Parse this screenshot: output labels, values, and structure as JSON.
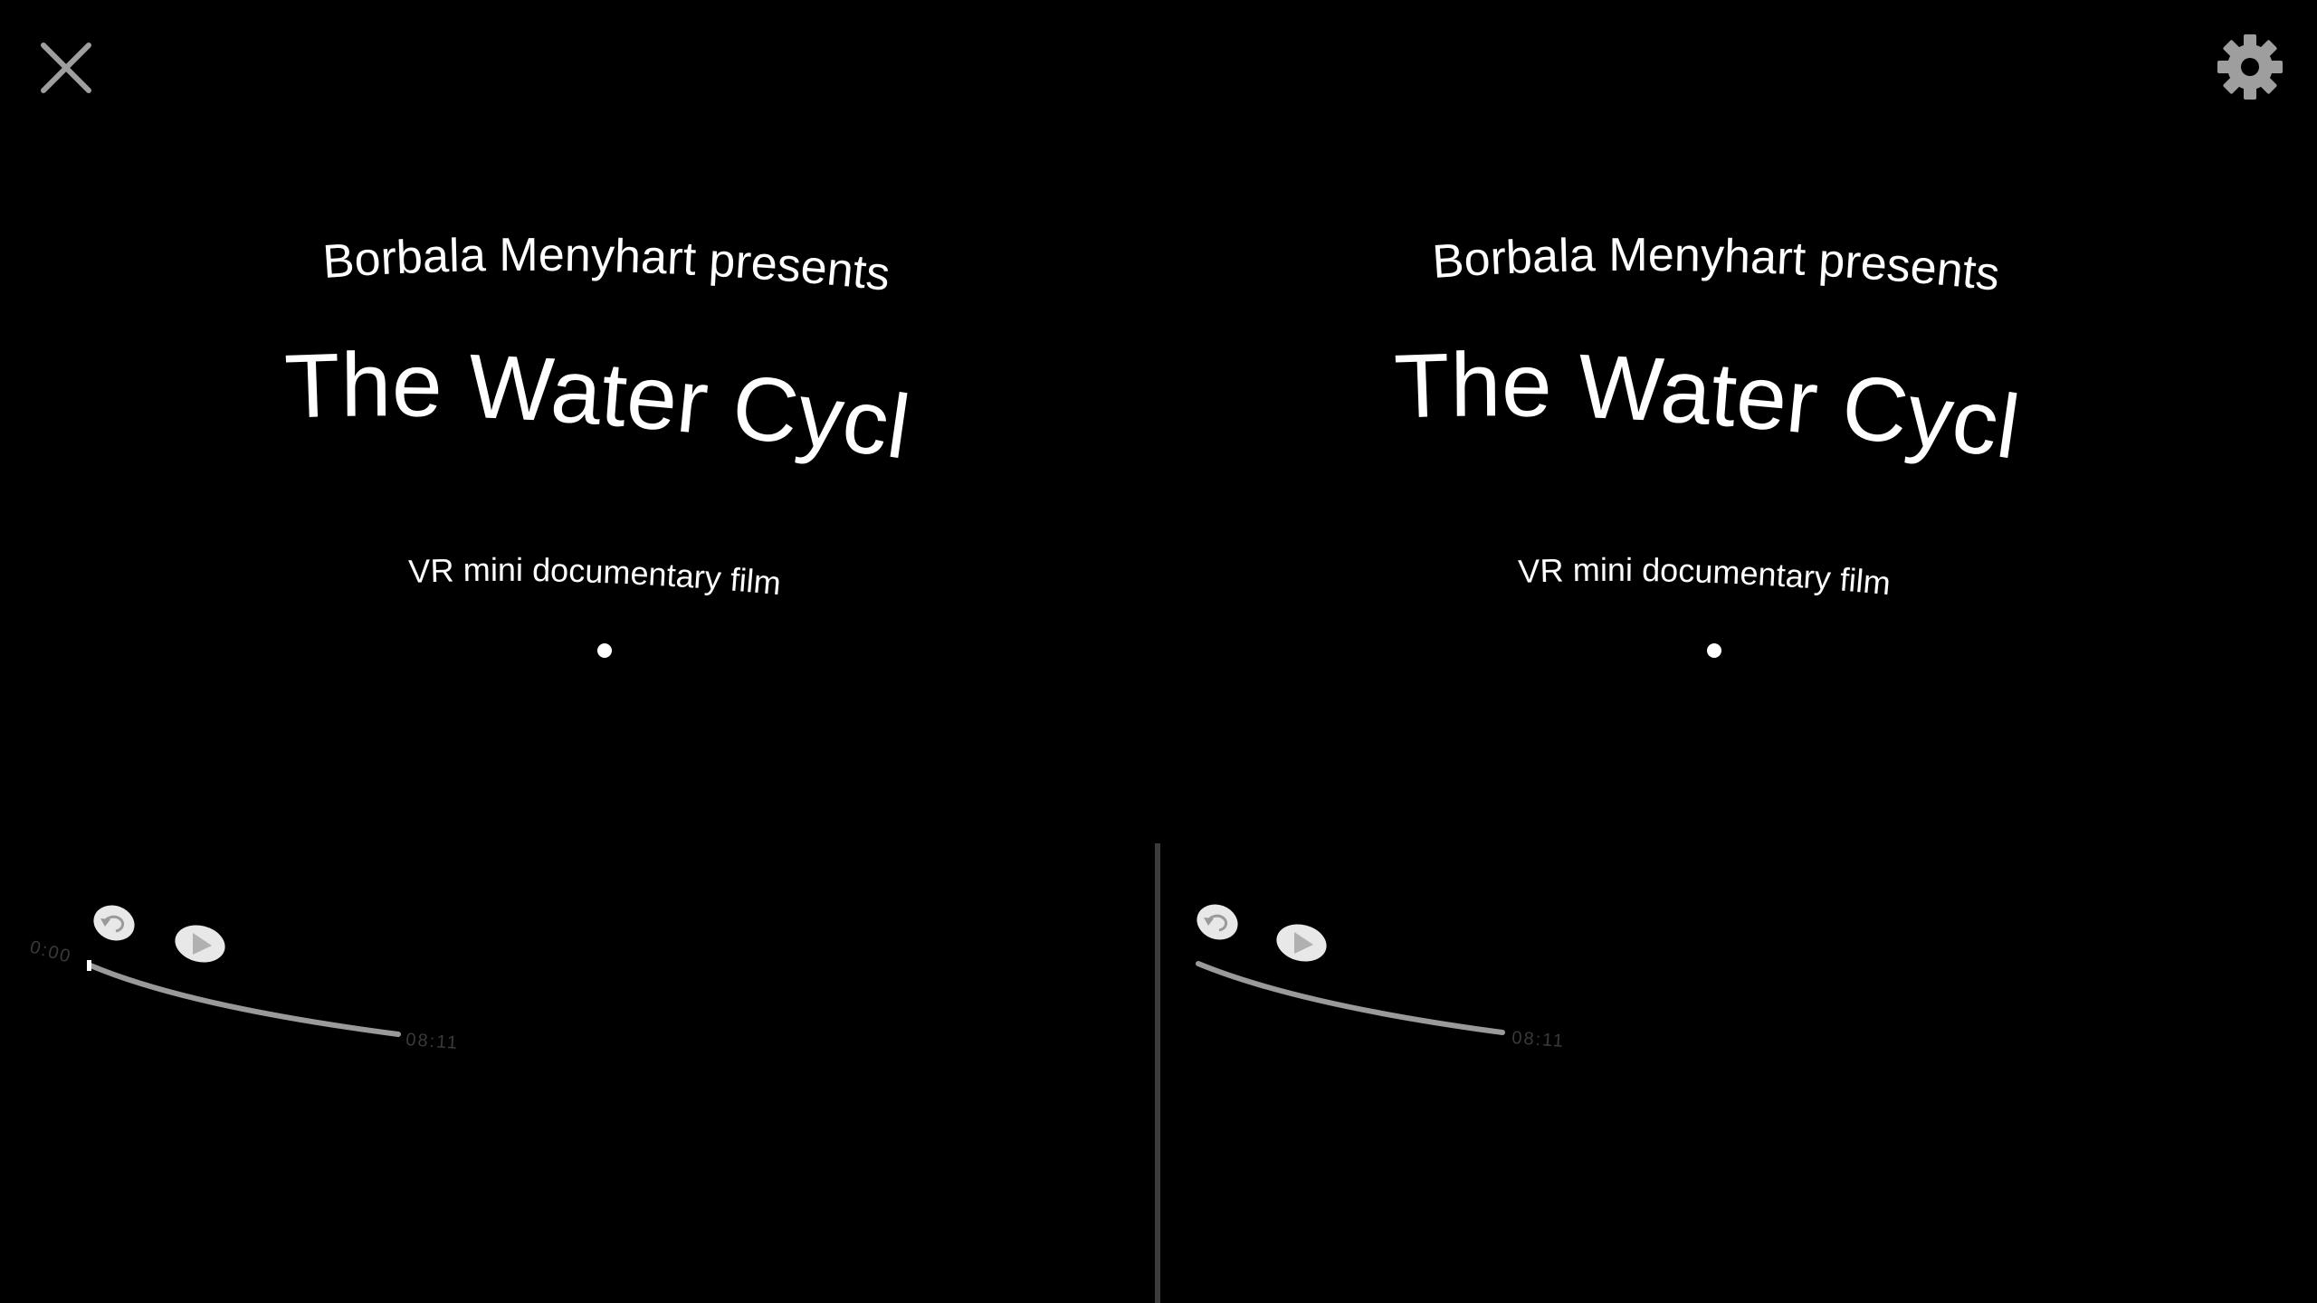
{
  "window": {
    "close_icon": "close-icon",
    "settings_icon": "gear-icon"
  },
  "intro": {
    "presenter": "Borbala Menyhart presents",
    "title": "The Water Cycle",
    "subtitle": "VR mini documentary film"
  },
  "player": {
    "current_time": "0:00",
    "duration": "08:11",
    "progress": 0,
    "replay_icon": "replay-icon",
    "play_icon": "play-icon"
  },
  "colors": {
    "background": "#000000",
    "text": "#ffffff",
    "track": "#9a9a9a",
    "divider": "#3c3c3c"
  }
}
